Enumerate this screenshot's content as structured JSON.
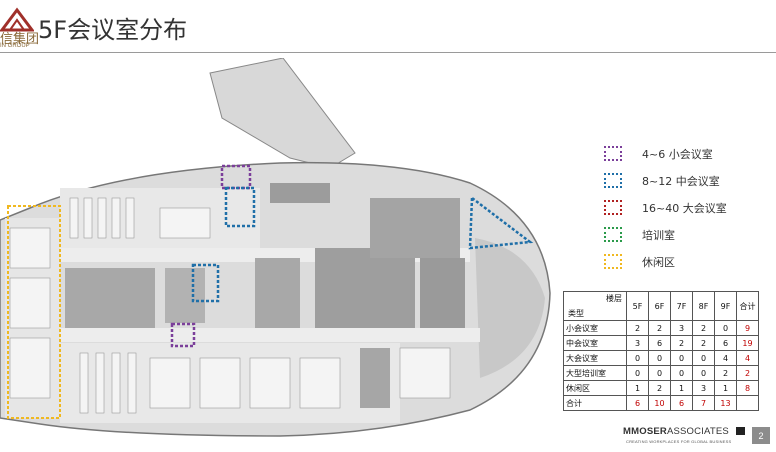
{
  "header": {
    "logo_text": "信集团",
    "logo_subtext": "IN GROUP",
    "title": "5F会议室分布"
  },
  "legend": [
    {
      "label": "4~6 小会议室",
      "color": "#7b3f9a"
    },
    {
      "label": "8~12 中会议室",
      "color": "#1f6fa8"
    },
    {
      "label": "16~40 大会议室",
      "color": "#b02020"
    },
    {
      "label": "培训室",
      "color": "#2a9a4a"
    },
    {
      "label": "休闲区",
      "color": "#f0b820"
    }
  ],
  "table": {
    "corner_top": "楼层",
    "corner_bottom": "类型",
    "floors": [
      "5F",
      "6F",
      "7F",
      "8F",
      "9F",
      "合计"
    ],
    "rows": [
      {
        "name": "小会议室",
        "values": [
          "2",
          "2",
          "3",
          "2",
          "0"
        ],
        "total": "9"
      },
      {
        "name": "中会议室",
        "values": [
          "3",
          "6",
          "2",
          "2",
          "6"
        ],
        "total": "19"
      },
      {
        "name": "大会议室",
        "values": [
          "0",
          "0",
          "0",
          "0",
          "4"
        ],
        "total": "4"
      },
      {
        "name": "大型培训室",
        "values": [
          "0",
          "0",
          "0",
          "0",
          "2"
        ],
        "total": "2"
      },
      {
        "name": "休闲区",
        "values": [
          "1",
          "2",
          "1",
          "3",
          "1"
        ],
        "total": "8"
      }
    ],
    "total_row": {
      "name": "合计",
      "values": [
        "6",
        "10",
        "6",
        "7",
        "13"
      ],
      "total": ""
    }
  },
  "footer": {
    "brand_bold": "MMOSER",
    "brand_rest": "ASSOCIATES",
    "tagline": "CREATING WORKPLACES FOR GLOBAL BUSINESS",
    "page_number": "2"
  }
}
